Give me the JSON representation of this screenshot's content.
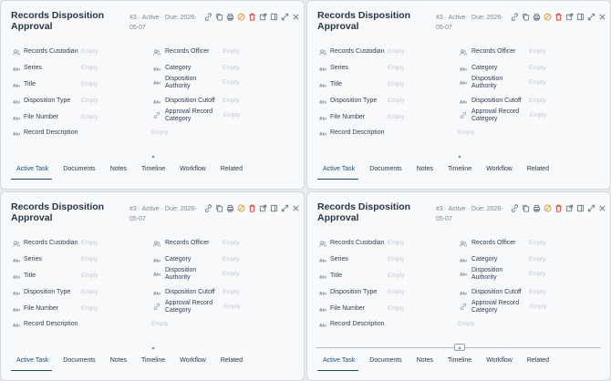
{
  "panels": [
    {
      "fold_button": "▴"
    },
    {
      "fold_button": "▴"
    },
    {
      "fold_button": "▴"
    },
    {
      "fold_button": "▴"
    }
  ],
  "record": {
    "title": "Records Disposition Approval",
    "meta": "#3 · Active · Due: 2026-05-07",
    "tool_icons": [
      "link-icon",
      "copy-icon",
      "print-icon",
      "cancel-icon",
      "delete-icon",
      "external-link-icon",
      "panel-icon",
      "expand-icon",
      "close-icon"
    ],
    "fields_left": [
      {
        "label": "Records Custodian",
        "value": "Empty",
        "icon": "user-group-icon"
      },
      {
        "label": "Series",
        "value": "Empty",
        "icon": "text-field-icon"
      },
      {
        "label": "Title",
        "value": "Empty",
        "icon": "text-field-icon"
      },
      {
        "label": "Disposition Type",
        "value": "Empty",
        "icon": "text-field-icon"
      },
      {
        "label": "File Number",
        "value": "Empty",
        "icon": "text-field-icon"
      },
      {
        "label": "Record Description",
        "value": "Empty",
        "icon": "text-field-icon"
      }
    ],
    "fields_right": [
      {
        "label": "Records Officer",
        "value": "Empty",
        "icon": "user-group-icon"
      },
      {
        "label": "Category",
        "value": "Empty",
        "icon": "text-field-icon"
      },
      {
        "label": "Disposition Authority",
        "value": "Empty",
        "icon": "text-field-icon"
      },
      {
        "label": "Disposition Cutoff",
        "value": "Empty",
        "icon": "text-field-icon"
      },
      {
        "label": "Approval Record Category",
        "value": "Empty",
        "icon": "link-field-icon"
      }
    ],
    "tabs": [
      "Active Task",
      "Documents",
      "Notes",
      "Timeline",
      "Workflow",
      "Related"
    ],
    "active_tab": "Active Task"
  },
  "colors": {
    "accent": "#1b4a7a",
    "cancel_icon": "#e8a23a",
    "delete_icon": "#d84a4a",
    "empty_value": "#c2c7d0"
  }
}
